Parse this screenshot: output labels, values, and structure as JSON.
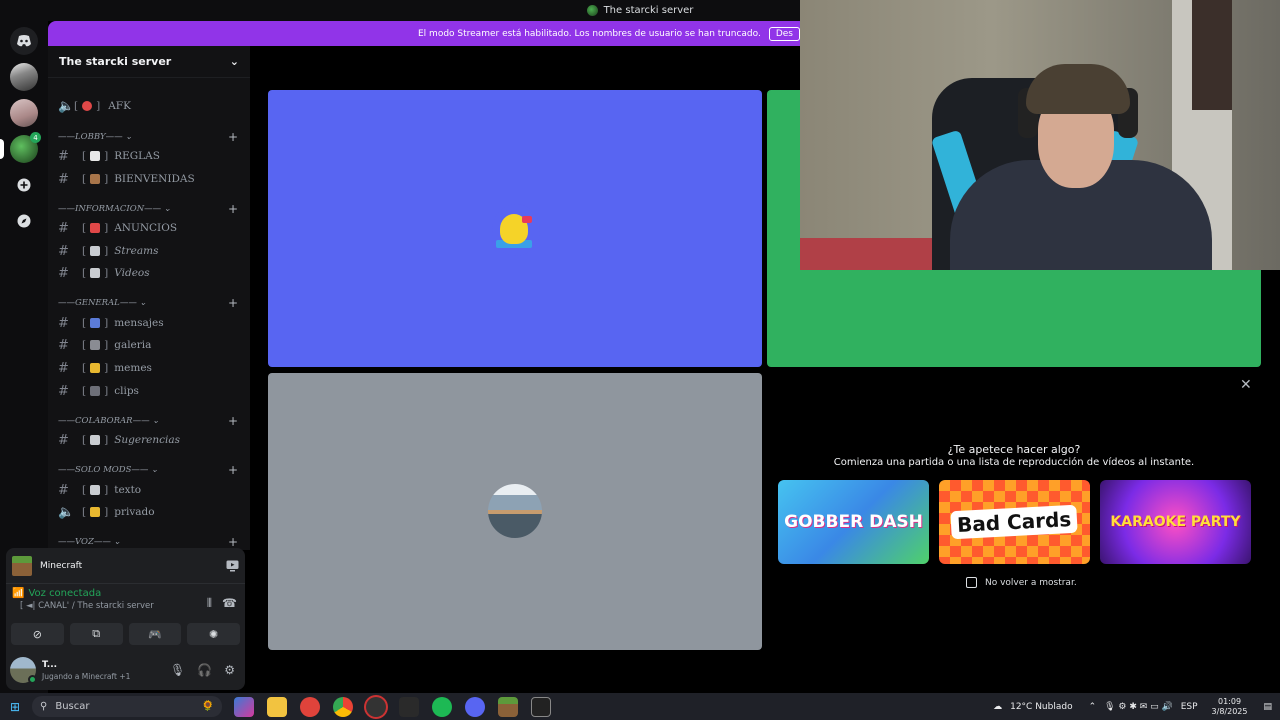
{
  "window": {
    "title": "The starcki server"
  },
  "banner": {
    "text": "El modo Streamer está habilitado. Los nombres de usuario se han truncado.",
    "button": "Des"
  },
  "guilds": {
    "discord_icon": "discord-icon",
    "badge": "4"
  },
  "server": {
    "name": "The starcki server",
    "chevron": "⌄"
  },
  "channels": {
    "afk": "AFK",
    "cat_lobby": "——LOBBY—— ⌄",
    "reglas": "REGLAS",
    "bienvenidas": "BIENVENIDAS",
    "cat_info": "——INFORMACION—— ⌄",
    "anuncios": "ANUNCIOS",
    "streams": "Streams",
    "videos": "Videos",
    "cat_general": "——GENERAL—— ⌄",
    "mensajes": "mensajes",
    "galeria": "galeria",
    "memes": "memes",
    "clips": "clips",
    "cat_colaborar": "——COLABORAR—— ⌄",
    "sugerencias": "Sugerencias",
    "cat_solo_mods": "——SOLO MODS—— ⌄",
    "texto": "texto",
    "privado": "privado",
    "cat_voz": "——VOZ—— ⌄",
    "plus": "+",
    "hash": "#",
    "bracket_open": "[",
    "bracket_close": "]"
  },
  "panel": {
    "game_name": "Minecraft",
    "voice_status": "Voz conectada",
    "voice_channel": "[ ◄| CANAL' / The starcki server",
    "user_name": "T...",
    "user_activity": "Jugando a Minecraft +1"
  },
  "activity": {
    "title": "¿Te apetece hacer algo?",
    "subtitle": "Comienza una partida o una lista de reproducción de vídeos al instante.",
    "card1": "GOBBER DASH",
    "card2": "Bad Cards",
    "card3": "KARAOKE PARTY",
    "dont_show": "No volver a mostrar.",
    "close": "✕"
  },
  "taskbar": {
    "search_placeholder": "Buscar",
    "weather": "12°C  Nublado",
    "lang": "ESP",
    "time": "01:09",
    "date": "3/8/2025"
  },
  "colors": {
    "accent_purple": "#9134e8",
    "tile_blurple": "#5865f2",
    "tile_green": "#30b15f",
    "tile_gray": "#8f969e",
    "voice_green": "#23a559"
  }
}
